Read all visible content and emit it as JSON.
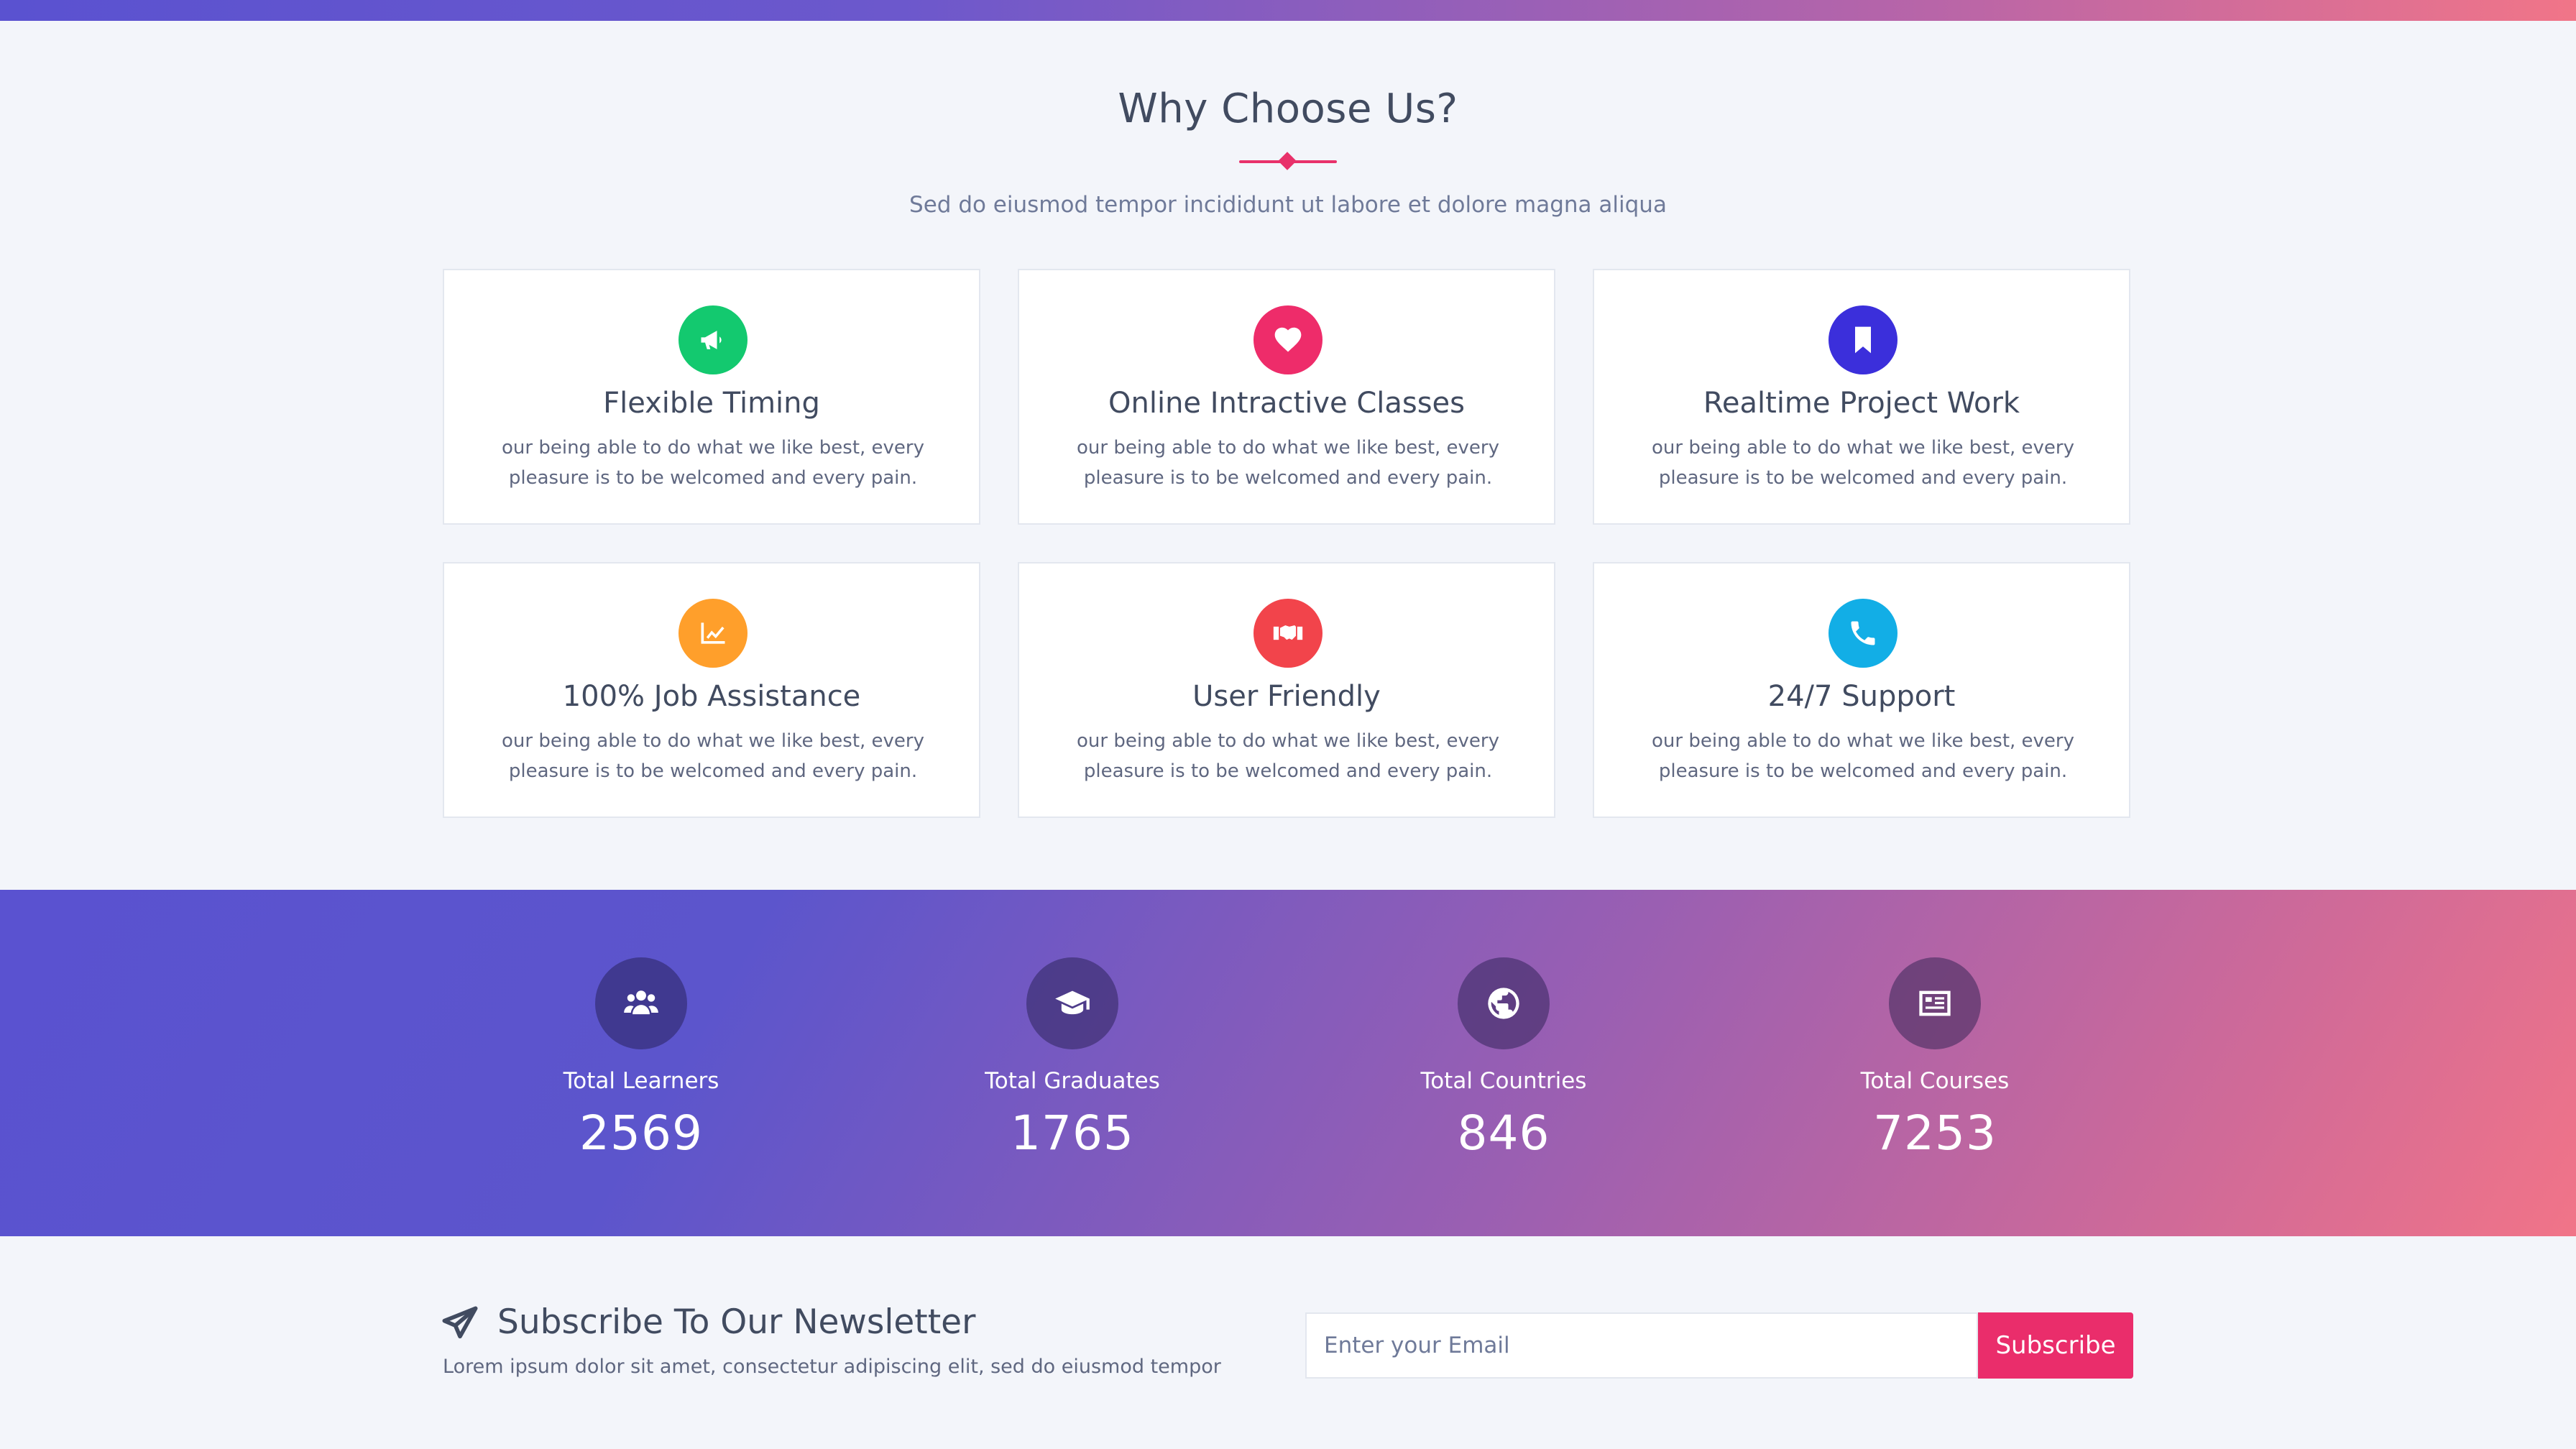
{
  "why": {
    "title": "Why Choose Us?",
    "subtitle": "Sed do eiusmod tempor incididunt ut labore et dolore magna aliqua",
    "cards": [
      {
        "title": "Flexible Timing",
        "text": "our being able to do what we like best, every pleasure is to be welcomed and every pain.",
        "icon": "megaphone-icon",
        "color": "#13c96f"
      },
      {
        "title": "Online Intractive Classes",
        "text": "our being able to do what we like best, every pleasure is to be welcomed and every pain.",
        "icon": "heart-icon",
        "color": "#ee2c6a"
      },
      {
        "title": "Realtime Project Work",
        "text": "our being able to do what we like best, every pleasure is to be welcomed and every pain.",
        "icon": "bookmark-icon",
        "color": "#3b2fdb"
      },
      {
        "title": "100% Job Assistance",
        "text": "our being able to do what we like best, every pleasure is to be welcomed and every pain.",
        "icon": "chart-icon",
        "color": "#ff9f2b"
      },
      {
        "title": "User Friendly",
        "text": "our being able to do what we like best, every pleasure is to be welcomed and every pain.",
        "icon": "handshake-icon",
        "color": "#f2444b"
      },
      {
        "title": "24/7 Support",
        "text": "our being able to do what we like best, every pleasure is to be welcomed and every pain.",
        "icon": "phone-icon",
        "color": "#12aee6"
      }
    ]
  },
  "stats": [
    {
      "label": "Total Learners",
      "value": "2569",
      "icon": "users-icon"
    },
    {
      "label": "Total Graduates",
      "value": "1765",
      "icon": "graduation-cap-icon"
    },
    {
      "label": "Total Countries",
      "value": "846",
      "icon": "globe-icon"
    },
    {
      "label": "Total Courses",
      "value": "7253",
      "icon": "courses-icon"
    }
  ],
  "newsletter": {
    "title": "Subscribe To Our Newsletter",
    "text": "Lorem ipsum dolor sit amet, consectetur adipiscing elit, sed do eiusmod tempor",
    "placeholder": "Enter your Email",
    "button_label": "Subscribe",
    "icon": "paper-plane-icon"
  },
  "colors": {
    "accent": "#ea2d6b",
    "gradient_start": "#5a52d0",
    "gradient_end": "#f17488"
  }
}
